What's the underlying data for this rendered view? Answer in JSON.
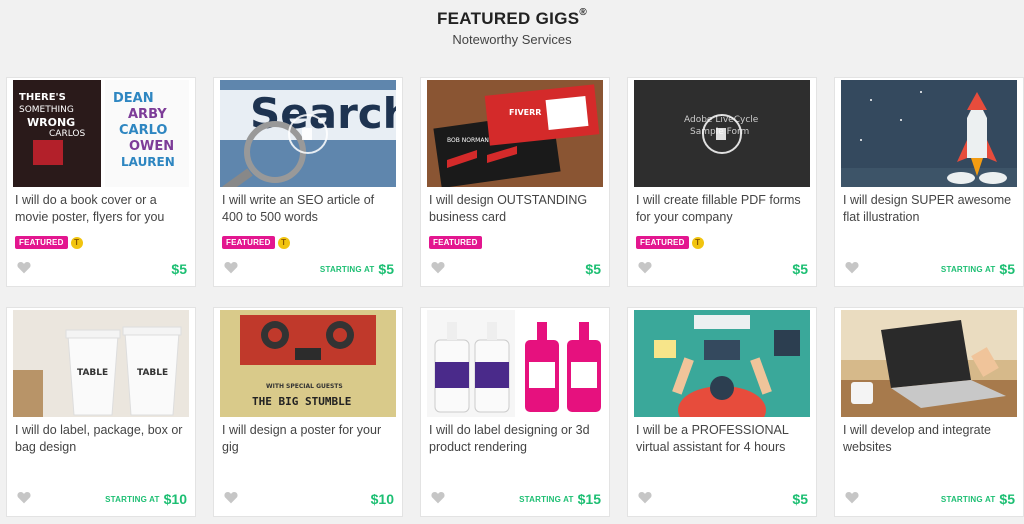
{
  "header": {
    "title": "FEATURED GIGS",
    "title_mark": "®",
    "subtitle": "Noteworthy Services"
  },
  "gigs": [
    {
      "title": "I will do a book cover or a movie poster, flyers for you",
      "featured": "FEATURED",
      "top": "T",
      "starting": "",
      "price": "$5",
      "thumb_text": [
        "THERE'S",
        "SOMETHING",
        "WRONG",
        "CARLOS",
        "DEAN",
        "ARBY",
        "CARLO",
        "OWEN",
        "LAUREN"
      ]
    },
    {
      "title": "I will write an SEO article of 400 to 500 words",
      "featured": "FEATURED",
      "top": "T",
      "starting": "STARTING AT",
      "price": "$5",
      "thumb_text": [
        "Search"
      ]
    },
    {
      "title": "I will design OUTSTANDING business card",
      "featured": "FEATURED",
      "top": "",
      "starting": "",
      "price": "$5",
      "thumb_text": [
        "FIVERR",
        "BOB NORMAN"
      ]
    },
    {
      "title": "I will create fillable PDF forms for your company",
      "featured": "FEATURED",
      "top": "T",
      "starting": "",
      "price": "$5",
      "thumb_text": [
        "Adobe LiveCycle",
        "Sample Form"
      ]
    },
    {
      "title": "I will design SUPER awesome flat illustration",
      "featured": "",
      "top": "",
      "starting": "STARTING AT",
      "price": "$5",
      "thumb_text": []
    },
    {
      "title": "I will do label, package, box or bag design",
      "featured": "",
      "top": "",
      "starting": "STARTING AT",
      "price": "$10",
      "thumb_text": [
        "TABLE",
        "TABLE"
      ]
    },
    {
      "title": "I will design a poster for your gig",
      "featured": "",
      "top": "",
      "starting": "",
      "price": "$10",
      "thumb_text": [
        "WITH SPECIAL GUESTS",
        "THE BIG STUMBLE"
      ]
    },
    {
      "title": "I will do label designing or 3d product rendering",
      "featured": "",
      "top": "",
      "starting": "STARTING AT",
      "price": "$15",
      "thumb_text": []
    },
    {
      "title": "I will be a PROFESSIONAL virtual assistant for 4 hours",
      "featured": "",
      "top": "",
      "starting": "",
      "price": "$5",
      "thumb_text": []
    },
    {
      "title": "I will develop and integrate websites",
      "featured": "",
      "top": "",
      "starting": "STARTING AT",
      "price": "$5",
      "thumb_text": []
    }
  ],
  "colors": {
    "featured": "#e3168f",
    "price": "#1dbf73",
    "top_badge": "#f1c40f"
  }
}
